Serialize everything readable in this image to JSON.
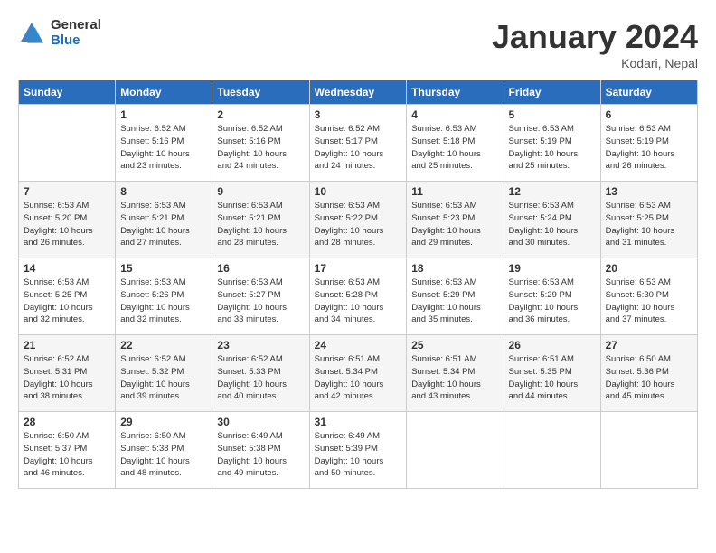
{
  "header": {
    "logo_general": "General",
    "logo_blue": "Blue",
    "title": "January 2024",
    "subtitle": "Kodari, Nepal"
  },
  "columns": [
    "Sunday",
    "Monday",
    "Tuesday",
    "Wednesday",
    "Thursday",
    "Friday",
    "Saturday"
  ],
  "weeks": [
    [
      {
        "day": "",
        "info": ""
      },
      {
        "day": "1",
        "info": "Sunrise: 6:52 AM\nSunset: 5:16 PM\nDaylight: 10 hours\nand 23 minutes."
      },
      {
        "day": "2",
        "info": "Sunrise: 6:52 AM\nSunset: 5:16 PM\nDaylight: 10 hours\nand 24 minutes."
      },
      {
        "day": "3",
        "info": "Sunrise: 6:52 AM\nSunset: 5:17 PM\nDaylight: 10 hours\nand 24 minutes."
      },
      {
        "day": "4",
        "info": "Sunrise: 6:53 AM\nSunset: 5:18 PM\nDaylight: 10 hours\nand 25 minutes."
      },
      {
        "day": "5",
        "info": "Sunrise: 6:53 AM\nSunset: 5:19 PM\nDaylight: 10 hours\nand 25 minutes."
      },
      {
        "day": "6",
        "info": "Sunrise: 6:53 AM\nSunset: 5:19 PM\nDaylight: 10 hours\nand 26 minutes."
      }
    ],
    [
      {
        "day": "7",
        "info": "Sunrise: 6:53 AM\nSunset: 5:20 PM\nDaylight: 10 hours\nand 26 minutes."
      },
      {
        "day": "8",
        "info": "Sunrise: 6:53 AM\nSunset: 5:21 PM\nDaylight: 10 hours\nand 27 minutes."
      },
      {
        "day": "9",
        "info": "Sunrise: 6:53 AM\nSunset: 5:21 PM\nDaylight: 10 hours\nand 28 minutes."
      },
      {
        "day": "10",
        "info": "Sunrise: 6:53 AM\nSunset: 5:22 PM\nDaylight: 10 hours\nand 28 minutes."
      },
      {
        "day": "11",
        "info": "Sunrise: 6:53 AM\nSunset: 5:23 PM\nDaylight: 10 hours\nand 29 minutes."
      },
      {
        "day": "12",
        "info": "Sunrise: 6:53 AM\nSunset: 5:24 PM\nDaylight: 10 hours\nand 30 minutes."
      },
      {
        "day": "13",
        "info": "Sunrise: 6:53 AM\nSunset: 5:25 PM\nDaylight: 10 hours\nand 31 minutes."
      }
    ],
    [
      {
        "day": "14",
        "info": "Sunrise: 6:53 AM\nSunset: 5:25 PM\nDaylight: 10 hours\nand 32 minutes."
      },
      {
        "day": "15",
        "info": "Sunrise: 6:53 AM\nSunset: 5:26 PM\nDaylight: 10 hours\nand 32 minutes."
      },
      {
        "day": "16",
        "info": "Sunrise: 6:53 AM\nSunset: 5:27 PM\nDaylight: 10 hours\nand 33 minutes."
      },
      {
        "day": "17",
        "info": "Sunrise: 6:53 AM\nSunset: 5:28 PM\nDaylight: 10 hours\nand 34 minutes."
      },
      {
        "day": "18",
        "info": "Sunrise: 6:53 AM\nSunset: 5:29 PM\nDaylight: 10 hours\nand 35 minutes."
      },
      {
        "day": "19",
        "info": "Sunrise: 6:53 AM\nSunset: 5:29 PM\nDaylight: 10 hours\nand 36 minutes."
      },
      {
        "day": "20",
        "info": "Sunrise: 6:53 AM\nSunset: 5:30 PM\nDaylight: 10 hours\nand 37 minutes."
      }
    ],
    [
      {
        "day": "21",
        "info": "Sunrise: 6:52 AM\nSunset: 5:31 PM\nDaylight: 10 hours\nand 38 minutes."
      },
      {
        "day": "22",
        "info": "Sunrise: 6:52 AM\nSunset: 5:32 PM\nDaylight: 10 hours\nand 39 minutes."
      },
      {
        "day": "23",
        "info": "Sunrise: 6:52 AM\nSunset: 5:33 PM\nDaylight: 10 hours\nand 40 minutes."
      },
      {
        "day": "24",
        "info": "Sunrise: 6:51 AM\nSunset: 5:34 PM\nDaylight: 10 hours\nand 42 minutes."
      },
      {
        "day": "25",
        "info": "Sunrise: 6:51 AM\nSunset: 5:34 PM\nDaylight: 10 hours\nand 43 minutes."
      },
      {
        "day": "26",
        "info": "Sunrise: 6:51 AM\nSunset: 5:35 PM\nDaylight: 10 hours\nand 44 minutes."
      },
      {
        "day": "27",
        "info": "Sunrise: 6:50 AM\nSunset: 5:36 PM\nDaylight: 10 hours\nand 45 minutes."
      }
    ],
    [
      {
        "day": "28",
        "info": "Sunrise: 6:50 AM\nSunset: 5:37 PM\nDaylight: 10 hours\nand 46 minutes."
      },
      {
        "day": "29",
        "info": "Sunrise: 6:50 AM\nSunset: 5:38 PM\nDaylight: 10 hours\nand 48 minutes."
      },
      {
        "day": "30",
        "info": "Sunrise: 6:49 AM\nSunset: 5:38 PM\nDaylight: 10 hours\nand 49 minutes."
      },
      {
        "day": "31",
        "info": "Sunrise: 6:49 AM\nSunset: 5:39 PM\nDaylight: 10 hours\nand 50 minutes."
      },
      {
        "day": "",
        "info": ""
      },
      {
        "day": "",
        "info": ""
      },
      {
        "day": "",
        "info": ""
      }
    ]
  ]
}
